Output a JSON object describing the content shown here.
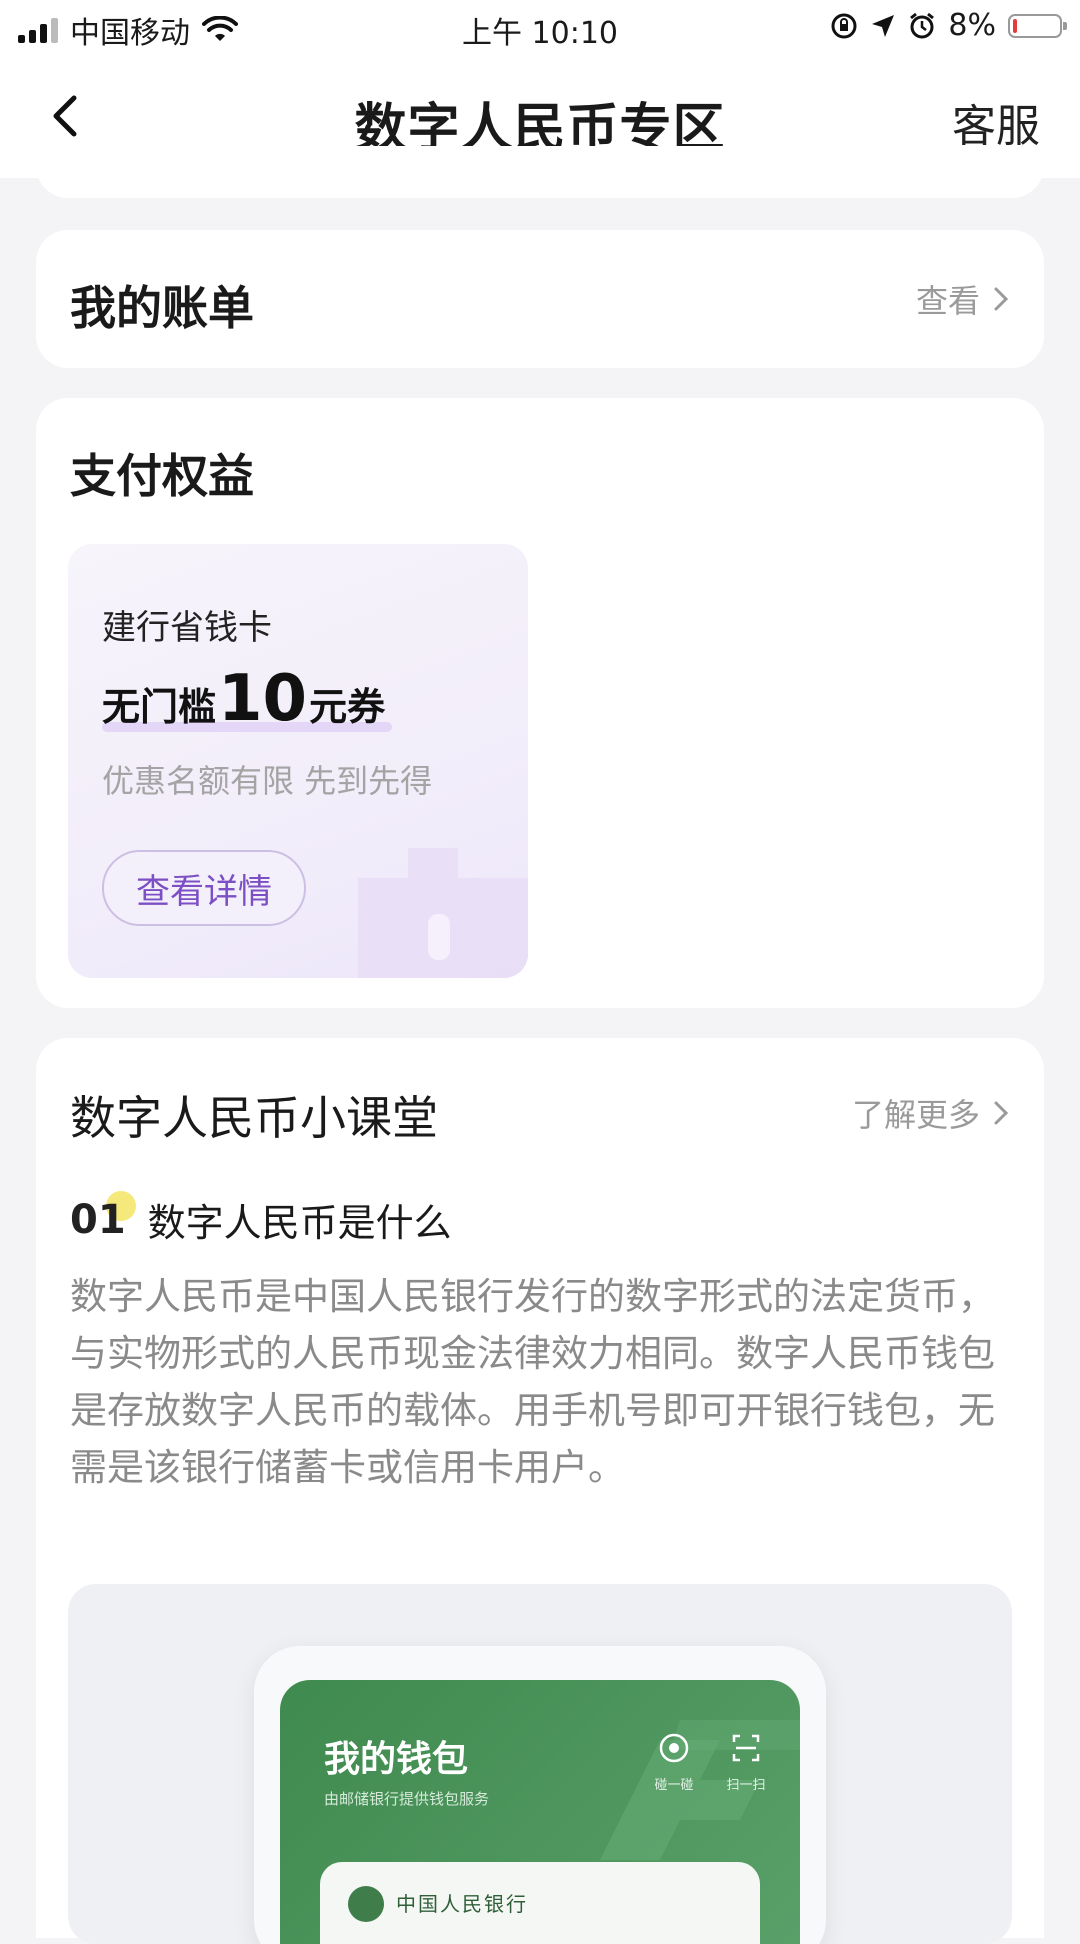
{
  "status_bar": {
    "carrier": "中国移动",
    "time": "上午 10:10",
    "battery": "8%",
    "icons": [
      "signal-icon",
      "wifi-icon",
      "orientation-lock-icon",
      "location-icon",
      "alarm-icon",
      "battery-icon"
    ]
  },
  "nav": {
    "title": "数字人民币专区",
    "service": "客服",
    "back_icon": "chevron-left-icon"
  },
  "bill": {
    "title": "我的账单",
    "action": "查看"
  },
  "benefits": {
    "title": "支付权益",
    "coupon": {
      "brand": "建行省钱卡",
      "offer_pre": "无门槛",
      "offer_amount": "10",
      "offer_post": "元券",
      "note": "优惠名额有限 先到先得",
      "button": "查看详情"
    }
  },
  "classroom": {
    "title": "数字人民币小课堂",
    "action": "了解更多",
    "lesson": {
      "number": "01",
      "title": "数字人民币是什么",
      "body": "数字人民币是中国人民银行发行的数字形式的法定货币，与实物形式的人民币现金法律效力相同。数字人民币钱包是存放数字人民币的载体。用手机号即可开银行钱包，无需是该银行储蓄卡或信用卡用户。"
    },
    "preview": {
      "wallet_title": "我的钱包",
      "wallet_subtitle": "由邮储银行提供钱包服务",
      "tool_tap": "碰一碰",
      "tool_scan": "扫一扫",
      "bank_name": "中国人民银行"
    }
  },
  "colors": {
    "accent_purple": "#7c4fc4",
    "wallet_green": "#4a935b",
    "page_bg": "#f4f4f6"
  }
}
